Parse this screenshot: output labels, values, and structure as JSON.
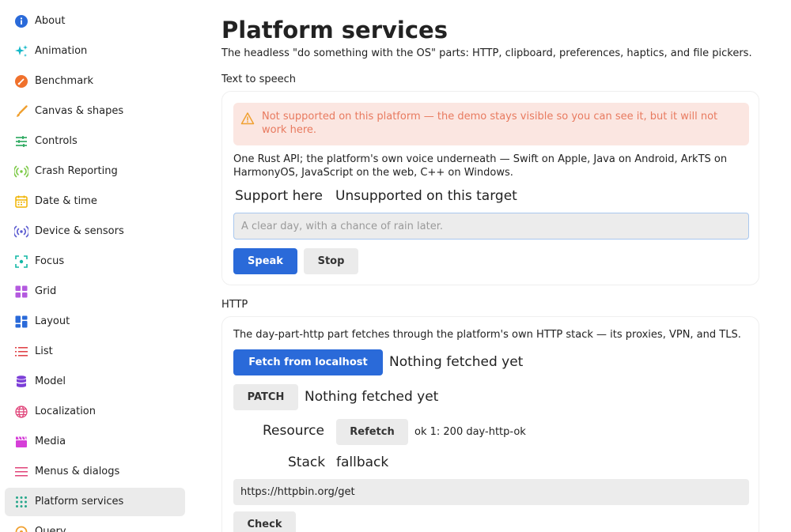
{
  "sidebar": {
    "items": [
      {
        "label": "About",
        "icon": "info-icon",
        "color": "#2a6ad9"
      },
      {
        "label": "Animation",
        "icon": "sparkle-icon",
        "color": "#14b8c8"
      },
      {
        "label": "Benchmark",
        "icon": "gauge-icon",
        "color": "#f0712c"
      },
      {
        "label": "Canvas & shapes",
        "icon": "brush-icon",
        "color": "#f0a030"
      },
      {
        "label": "Controls",
        "icon": "sliders-icon",
        "color": "#26a65b"
      },
      {
        "label": "Crash Reporting",
        "icon": "signal-icon",
        "color": "#7ac943"
      },
      {
        "label": "Date & time",
        "icon": "calendar-icon",
        "color": "#f0b400"
      },
      {
        "label": "Device & sensors",
        "icon": "broadcast-icon",
        "color": "#5a5ad0"
      },
      {
        "label": "Focus",
        "icon": "focus-icon",
        "color": "#14b8a6"
      },
      {
        "label": "Grid",
        "icon": "grid-icon",
        "color": "#b45adf"
      },
      {
        "label": "Layout",
        "icon": "layout-icon",
        "color": "#2a6ad9"
      },
      {
        "label": "List",
        "icon": "list-icon",
        "color": "#e0454a"
      },
      {
        "label": "Model",
        "icon": "database-icon",
        "color": "#7c3fd8"
      },
      {
        "label": "Localization",
        "icon": "globe-icon",
        "color": "#e0457a"
      },
      {
        "label": "Media",
        "icon": "clapper-icon",
        "color": "#d63fd8"
      },
      {
        "label": "Menus & dialogs",
        "icon": "menu-icon",
        "color": "#e0457a"
      },
      {
        "label": "Platform services",
        "icon": "dots-grid-icon",
        "color": "#26a68a"
      },
      {
        "label": "Query",
        "icon": "query-icon",
        "color": "#f0a030"
      }
    ],
    "active_index": 16
  },
  "page": {
    "title": "Platform services",
    "subtitle": "The headless \"do something with the OS\" parts: HTTP, clipboard, preferences, haptics, and file pickers."
  },
  "tts": {
    "section_label": "Text to speech",
    "warning": "Not supported on this platform — the demo stays visible so you can see it, but it will not work here.",
    "description": "One Rust API; the platform's own voice underneath — Swift on Apple, Java on Android, ArkTS on HarmonyOS, JavaScript on the web, C++ on Windows.",
    "support_label": "Support here",
    "support_value": "Unsupported on this target",
    "input_value": "",
    "input_placeholder": "A clear day, with a chance of rain later.",
    "speak_label": "Speak",
    "stop_label": "Stop"
  },
  "http": {
    "section_label": "HTTP",
    "description": "The day-part-http part fetches through the platform's own HTTP stack — its proxies, VPN, and TLS.",
    "fetch_label": "Fetch from localhost",
    "fetch_status": "Nothing fetched yet",
    "patch_label": "PATCH",
    "patch_status": "Nothing fetched yet",
    "resource_label": "Resource",
    "refetch_label": "Refetch",
    "resource_status": "ok 1: 200 day-http-ok",
    "stack_label": "Stack",
    "stack_value": "fallback",
    "url_value": "https://httpbin.org/get",
    "check_label": "Check"
  },
  "colors": {
    "primary": "#2a6ad9",
    "warning_bg": "#fbe6e1",
    "warning_text": "#e87a5f"
  }
}
